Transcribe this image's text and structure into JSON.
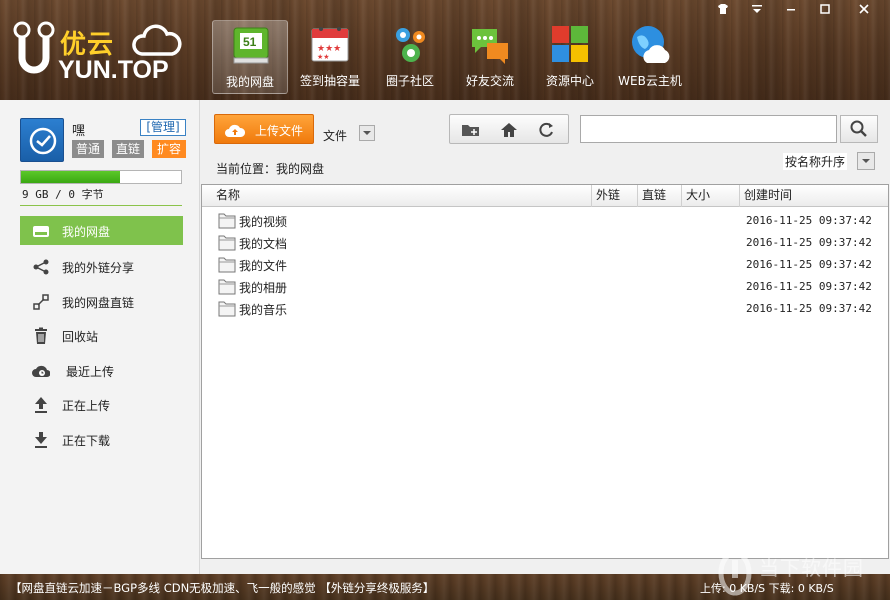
{
  "app": {
    "logo_cn": "优云",
    "logo_en": "YUN.TOP"
  },
  "window_controls": {
    "skin": "skin-icon",
    "menu": "menu-icon",
    "minimize": "minimize-icon",
    "maximize": "maximize-icon",
    "close": "close-icon"
  },
  "nav": [
    {
      "label": "我的网盘",
      "icon": "cloud-disk-icon",
      "active": true
    },
    {
      "label": "签到抽容量",
      "icon": "calendar-icon",
      "active": false
    },
    {
      "label": "圈子社区",
      "icon": "community-icon",
      "active": false
    },
    {
      "label": "好友交流",
      "icon": "chat-icon",
      "active": false
    },
    {
      "label": "资源中心",
      "icon": "resource-icon",
      "active": false
    },
    {
      "label": "WEB云主机",
      "icon": "globe-cloud-icon",
      "active": false
    }
  ],
  "user": {
    "name": "嘿",
    "manage_label": "[管理]",
    "tags": [
      "普通",
      "直链",
      "扩容"
    ],
    "quota_fraction": 0.62,
    "quota_text": "9 GB / 0 字节"
  },
  "sidebar": {
    "items": [
      {
        "label": "我的网盘",
        "icon": "disk-icon",
        "active": true
      },
      {
        "label": "我的外链分享",
        "icon": "share-icon",
        "active": false
      },
      {
        "label": "我的网盘直链",
        "icon": "direct-link-icon",
        "active": false
      },
      {
        "label": "回收站",
        "icon": "trash-icon",
        "active": false
      },
      {
        "label": "最近上传",
        "icon": "recent-upload-icon",
        "active": false
      },
      {
        "label": "正在上传",
        "icon": "upload-icon",
        "active": false
      },
      {
        "label": "正在下载",
        "icon": "download-icon",
        "active": false
      }
    ]
  },
  "toolbar": {
    "upload_label": "上传文件",
    "type_value": "文件",
    "search_placeholder": "",
    "location_label": "当前位置：我的网盘",
    "sort_value": "按名称升序"
  },
  "table": {
    "headers": [
      "名称",
      "外链",
      "直链",
      "大小",
      "创建时间"
    ],
    "rows": [
      {
        "name": "我的视频",
        "ext": "",
        "direct": "",
        "size": "",
        "created": "2016-11-25 09:37:42"
      },
      {
        "name": "我的文档",
        "ext": "",
        "direct": "",
        "size": "",
        "created": "2016-11-25 09:37:42"
      },
      {
        "name": "我的文件",
        "ext": "",
        "direct": "",
        "size": "",
        "created": "2016-11-25 09:37:42"
      },
      {
        "name": "我的相册",
        "ext": "",
        "direct": "",
        "size": "",
        "created": "2016-11-25 09:37:42"
      },
      {
        "name": "我的音乐",
        "ext": "",
        "direct": "",
        "size": "",
        "created": "2016-11-25 09:37:42"
      }
    ]
  },
  "status": {
    "left": "【网盘直链云加速－BGP多线 CDN无极加速、飞一般的感觉 【外链分享终极服务】",
    "right": "上传: 0 KB/S  下载: 0 KB/S"
  },
  "watermark": "当下软件园",
  "colors": {
    "accent_green": "#7fc24c",
    "upload_orange": "#f58a1f",
    "logo_yellow": "#ffcf2a",
    "wood": "#5a3b24"
  }
}
